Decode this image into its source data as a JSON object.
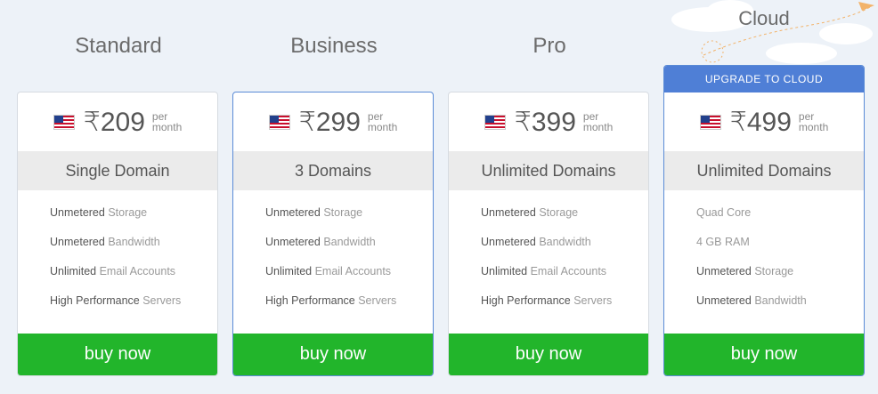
{
  "plans": [
    {
      "title": "Standard",
      "price": "₹209",
      "per1": "per",
      "per2": "month",
      "domains": "Single Domain",
      "features": [
        {
          "strong": "Unmetered",
          "rest": " Storage"
        },
        {
          "strong": "Unmetered",
          "rest": " Bandwidth"
        },
        {
          "strong": "Unlimited",
          "rest": " Email Accounts"
        },
        {
          "strong": "High Performance",
          "rest": " Servers"
        }
      ],
      "buy": "buy now"
    },
    {
      "title": "Business",
      "price": "₹299",
      "per1": "per",
      "per2": "month",
      "domains": "3 Domains",
      "features": [
        {
          "strong": "Unmetered",
          "rest": " Storage"
        },
        {
          "strong": "Unmetered",
          "rest": " Bandwidth"
        },
        {
          "strong": "Unlimited",
          "rest": " Email Accounts"
        },
        {
          "strong": "High Performance",
          "rest": " Servers"
        }
      ],
      "buy": "buy now"
    },
    {
      "title": "Pro",
      "price": "₹399",
      "per1": "per",
      "per2": "month",
      "domains": "Unlimited Domains",
      "features": [
        {
          "strong": "Unmetered",
          "rest": " Storage"
        },
        {
          "strong": "Unmetered",
          "rest": " Bandwidth"
        },
        {
          "strong": "Unlimited",
          "rest": " Email Accounts"
        },
        {
          "strong": "High Performance",
          "rest": " Servers"
        }
      ],
      "buy": "buy now"
    },
    {
      "title": "Cloud",
      "banner": "UPGRADE TO CLOUD",
      "price": "₹499",
      "per1": "per",
      "per2": "month",
      "domains": "Unlimited Domains",
      "features": [
        {
          "strong": "",
          "rest": "Quad Core"
        },
        {
          "strong": "",
          "rest": "4 GB RAM"
        },
        {
          "strong": "Unmetered",
          "rest": " Storage"
        },
        {
          "strong": "Unmetered",
          "rest": " Bandwidth"
        }
      ],
      "buy": "buy now"
    }
  ],
  "colors": {
    "buy": "#22b52b",
    "banner": "#4f7fd6",
    "background": "#edf2f8"
  },
  "icons": {
    "flag": "us-flag-icon",
    "cloud": "cloud-illustration"
  }
}
